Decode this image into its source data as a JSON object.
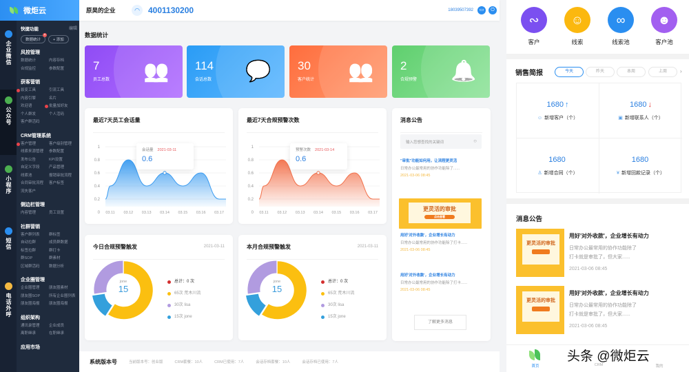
{
  "brand": {
    "name": "微炬云"
  },
  "rail": [
    {
      "label": "企业微信",
      "icon": "wecom-icon",
      "color": "#2a8ef0"
    },
    {
      "label": "公众号",
      "icon": "wechat-icon",
      "color": "#4caf50"
    },
    {
      "label": "小程序",
      "icon": "miniprogram-icon",
      "color": "#4caf50"
    },
    {
      "label": "短信",
      "icon": "sms-icon",
      "color": "#2a8ef0"
    },
    {
      "label": "电话外呼",
      "icon": "phone-icon",
      "color": "#f4b942"
    }
  ],
  "quick": {
    "title": "快捷功能",
    "edit": "编辑",
    "chips": [
      "数据统计",
      "+ 添加"
    ],
    "remove": "×"
  },
  "menu": [
    {
      "title": "风控管理",
      "items": [
        "数据统计",
        "内容存档",
        "合规监控",
        "参数配置"
      ]
    },
    {
      "title": "获客营销",
      "items": [
        "裂变工具",
        "引流工具",
        "内容引擎",
        "名片",
        "欢迎语",
        "批量加好友",
        "个人群发",
        "个人活码",
        "客户群活码"
      ],
      "hot": [
        0,
        5
      ]
    },
    {
      "title": "CRM管理系统",
      "items": [
        "客户管理",
        "客户级别管理",
        "线索来源管理",
        "参数配置",
        "发布公告",
        "KPI设置",
        "自定义字段",
        "产品管理",
        "线索池",
        "报销审批流程",
        "合同审批流程",
        "客户标签",
        "流失客户"
      ],
      "hot": [
        0
      ]
    },
    {
      "title": "侧边栏管理",
      "items": [
        "内容管理",
        "员工设置"
      ]
    },
    {
      "title": "社群营销",
      "items": [
        "客户群列表",
        "群标签",
        "自动拉群",
        "成员群数据",
        "标签拉群",
        "群打卡",
        "群SOP",
        "群素材",
        "区域群活码",
        "数据分析"
      ]
    },
    {
      "title": "企业圈管理",
      "items": [
        "企业圈管理",
        "朋友圈素材",
        "朋友圈SOP",
        "所有企业圈列表",
        "朋友圈海报",
        "朋友圈海报"
      ]
    },
    {
      "title": "组织架构",
      "items": [
        "通讯录管理",
        "企业成员",
        "离职继承",
        "在职继承"
      ]
    },
    {
      "title": "应用市场",
      "items": []
    }
  ],
  "header": {
    "company": "原昊的企业",
    "hotline": "4001130200",
    "account": "18039507392"
  },
  "stats": {
    "title": "数据统计",
    "cards": [
      {
        "value": "7",
        "label": "员工总数",
        "icon": "users-icon",
        "glyph": "👥",
        "bg": "linear-gradient(135deg,#8f4cf5,#b06cff)"
      },
      {
        "value": "114",
        "label": "会话总数",
        "icon": "chat-icon",
        "glyph": "💬",
        "bg": "linear-gradient(135deg,#2a9cf5,#5bb6ff)"
      },
      {
        "value": "30",
        "label": "客户统计",
        "icon": "customers-icon",
        "glyph": "👥",
        "bg": "linear-gradient(135deg,#ff6d3d,#ff9a6e)"
      },
      {
        "value": "2",
        "label": "合规预警",
        "icon": "bell-icon",
        "glyph": "🔔",
        "bg": "linear-gradient(135deg,#5fcf6e,#8ee39a)"
      }
    ]
  },
  "chart_data": [
    {
      "type": "area",
      "title": "最近7天员工会话量",
      "categories": [
        "03.11",
        "03.12",
        "03.13",
        "03.14",
        "03.15",
        "03.16",
        "03.17"
      ],
      "values": [
        0.4,
        0.8,
        0.4,
        0.6,
        0.4,
        0.6,
        0.2
      ],
      "ylim": [
        0,
        1
      ],
      "yticks": [
        "0",
        "0.2",
        "0.4",
        "0.6",
        "0.8",
        "1"
      ],
      "color": "#3a9bf0",
      "tooltip": {
        "label": "会话量",
        "date": "2021-03-11",
        "value": "0.6"
      }
    },
    {
      "type": "area",
      "title": "最近7天合规预警次数",
      "categories": [
        "03.11",
        "03.12",
        "03.13",
        "03.14",
        "03.15",
        "03.16",
        "03.17"
      ],
      "values": [
        0.4,
        0.8,
        0.4,
        0.6,
        0.4,
        0.6,
        0.2
      ],
      "ylim": [
        0,
        1
      ],
      "yticks": [
        "0",
        "0.2",
        "0.4",
        "0.6",
        "0.8",
        "1"
      ],
      "color": "#f2704a",
      "tooltip": {
        "label": "预警次数",
        "date": "2021-03-14",
        "value": "0.6"
      }
    },
    {
      "type": "pie",
      "title": "今日合规预警触发",
      "date": "2021-03-11",
      "total": "总计：0 次",
      "center": {
        "name": "jone",
        "value": "15"
      },
      "slices": [
        {
          "name": "荒木川流",
          "value": 65,
          "label": "65次  荒木川流",
          "color": "#fbbf10"
        },
        {
          "name": "jone",
          "value": 15,
          "label": "15次   jone",
          "color": "#34a0dc"
        },
        {
          "name": "lisa",
          "value": 30,
          "label": "30次  lisa",
          "color": "#b19be0"
        }
      ]
    },
    {
      "type": "pie",
      "title": "本月合规预警触发",
      "date": "2021-03-11",
      "total": "总计：0 次",
      "center": {
        "name": "jone",
        "value": "15"
      },
      "slices": [
        {
          "name": "荒木川流",
          "value": 65,
          "label": "65次  荒木川流",
          "color": "#fbbf10"
        },
        {
          "name": "jone",
          "value": 15,
          "label": "15次   jone",
          "color": "#34a0dc"
        },
        {
          "name": "lisa",
          "value": 30,
          "label": "30次  lisa",
          "color": "#b19be0"
        }
      ]
    }
  ],
  "notice": {
    "title": "消息公告",
    "search_placeholder": "输入您想查找的关键词",
    "items": [
      {
        "title": "\"审批\"功能如何用，让流程更灵活",
        "body": "日常办公最常用的协作功能除了......",
        "date": "2021-03-06 08:45"
      },
      {
        "title": "用好'对外收款'，企业增长有动力",
        "body": "日常办公最常用的协作功能除了打卡......",
        "date": "2021-03-06 08:45"
      },
      {
        "title": "用好'对外收款'，企业增长有动力",
        "body": "日常办公最常用的协作功能除了打卡......",
        "date": "2021-03-06 08:45"
      }
    ],
    "banner": "更灵活的审批",
    "banner_btn": "点击查看",
    "more": "了解更多消息"
  },
  "footer": {
    "title": "系统版本号",
    "fields": [
      "当前版本号：创业版",
      "CRM套餐：10人",
      "CRM已使用：7人",
      "会话存档套餐：10人",
      "会话存档已使用：7人"
    ]
  },
  "mobile": {
    "apps": [
      {
        "label": "客户",
        "color": "#7b4ff0",
        "glyph": "∾"
      },
      {
        "label": "线索",
        "color": "#fbb80f",
        "glyph": "☺"
      },
      {
        "label": "线索池",
        "color": "#2a8ef0",
        "glyph": "∞"
      },
      {
        "label": "客户池",
        "color": "#a25ff0",
        "glyph": "☻"
      }
    ],
    "sales": {
      "title": "销售简报",
      "tabs": [
        "今天",
        "昨天",
        "本周",
        "上周"
      ],
      "cells": [
        {
          "value": "1680",
          "trend": "↑",
          "trend_color": "#2a8ef0",
          "label": "新增客户（个）",
          "icon": "☺"
        },
        {
          "value": "1680",
          "trend": "↓",
          "trend_color": "#e53935",
          "label": "新增联系人（个）",
          "icon": "▣"
        },
        {
          "value": "1680",
          "trend": "",
          "trend_color": "#2a8ef0",
          "label": "新增合同（个）",
          "icon": "♙"
        },
        {
          "value": "1680",
          "trend": "",
          "trend_color": "#2a8ef0",
          "label": "新增回款记录（个）",
          "icon": "¥"
        }
      ]
    },
    "notice": {
      "title": "消息公告",
      "items": [
        {
          "title": "用好'对外收款'，企业增长有动力",
          "body1": "日常办公最常用的协作功能除了",
          "body2": "打卡就是审批了，但大家......",
          "date": "2021-03-06 08:45",
          "banner": "更灵活的审批"
        },
        {
          "title": "用好'对外收款'，企业增长有动力",
          "body1": "日常办公最常用的协作功能除了",
          "body2": "打卡就是审批了，但大家......",
          "date": "2021-03-06 08:45",
          "banner": "更灵活的审批"
        }
      ]
    },
    "tabbar": [
      "首页",
      "CRM",
      "我的"
    ],
    "watermark": "头条 @微炬云"
  }
}
